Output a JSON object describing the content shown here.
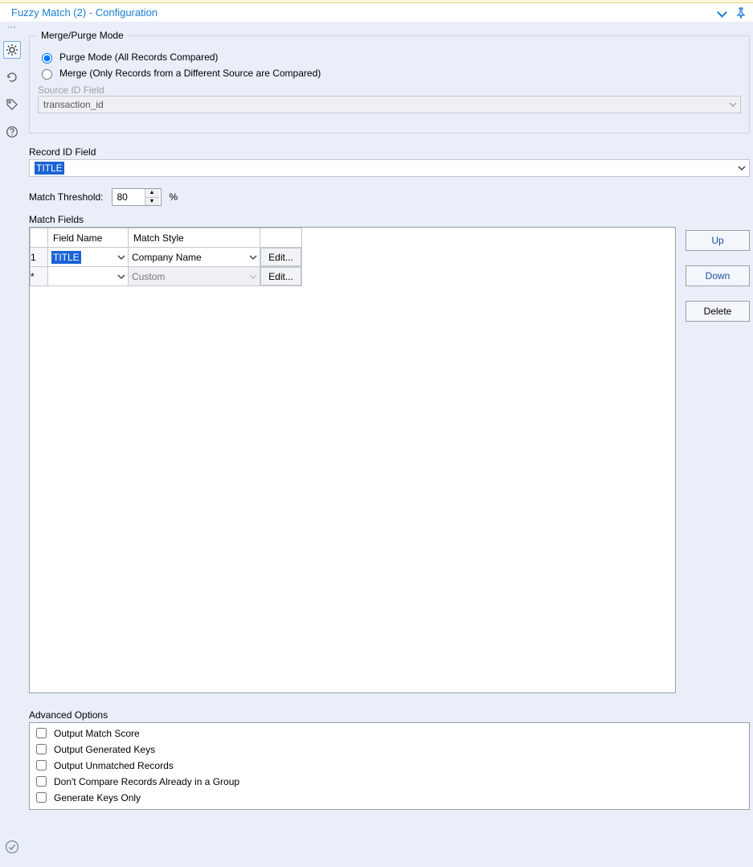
{
  "titlebar": {
    "title": "Fuzzy Match (2) - Configuration"
  },
  "merge_purge": {
    "legend": "Merge/Purge Mode",
    "option_purge": "Purge Mode (All Records Compared)",
    "option_merge": "Merge (Only Records from a Different Source are Compared)",
    "selected": "purge",
    "source_id_label": "Source ID Field",
    "source_id_value": "transaction_id"
  },
  "record_id": {
    "label": "Record ID Field",
    "value": "TITLE"
  },
  "threshold": {
    "label": "Match Threshold:",
    "value": "80",
    "unit": "%"
  },
  "match_fields": {
    "label": "Match Fields",
    "headers": {
      "field_name": "Field Name",
      "match_style": "Match Style"
    },
    "rows": [
      {
        "idx": "1",
        "field_name": "TITLE",
        "match_style": "Company Name",
        "edit": "Edit...",
        "new": false
      },
      {
        "idx": "*",
        "field_name": "",
        "match_style": "Custom",
        "edit": "Edit...",
        "new": true
      }
    ],
    "buttons": {
      "up": "Up",
      "down": "Down",
      "delete": "Delete"
    }
  },
  "advanced": {
    "label": "Advanced Options",
    "options": [
      {
        "label": "Output Match Score",
        "checked": false
      },
      {
        "label": "Output Generated Keys",
        "checked": false
      },
      {
        "label": "Output Unmatched Records",
        "checked": false
      },
      {
        "label": "Don't Compare Records Already in a Group",
        "checked": false
      },
      {
        "label": "Generate Keys Only",
        "checked": false
      }
    ]
  }
}
